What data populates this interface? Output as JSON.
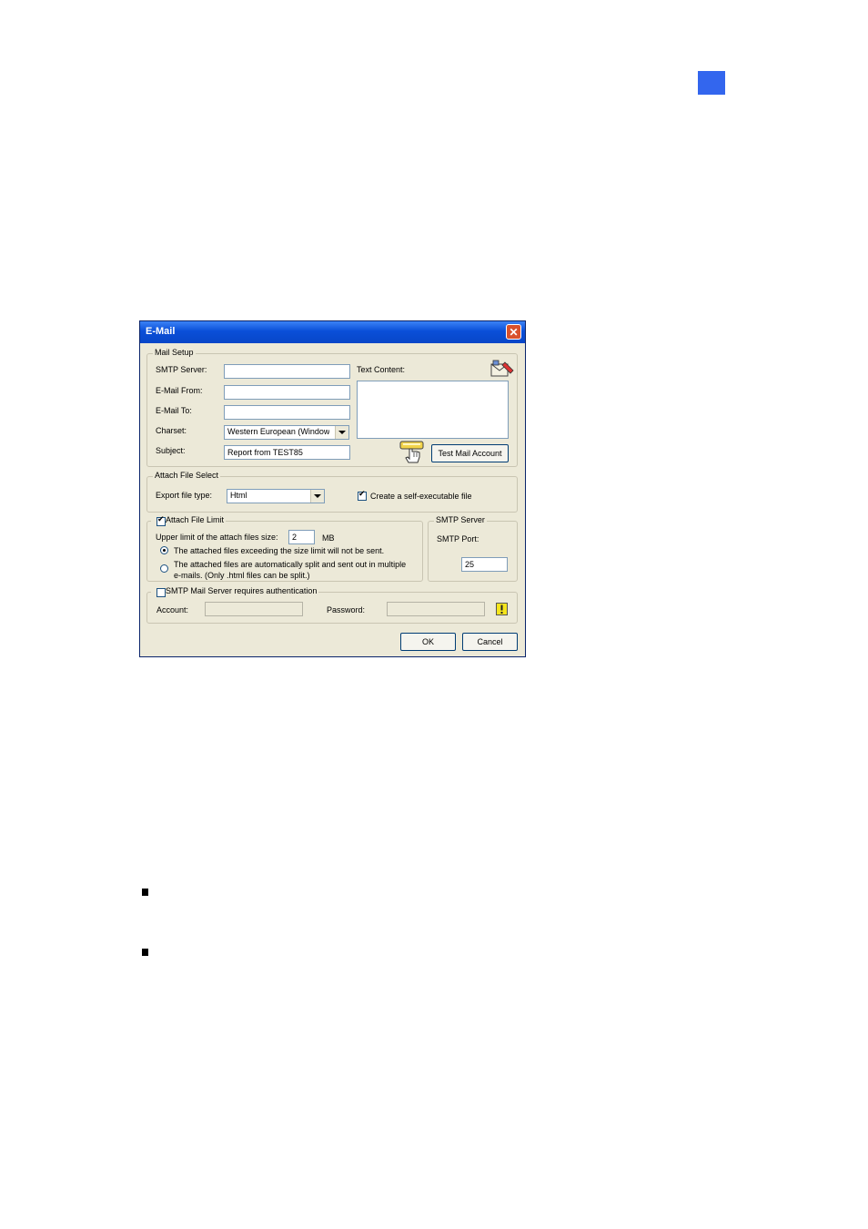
{
  "dialog": {
    "title": "E-Mail",
    "close_glyph": "✕",
    "mail_setup": {
      "legend": "Mail Setup",
      "smtp_server_label": "SMTP Server:",
      "smtp_server_value": "",
      "email_from_label": "E-Mail From:",
      "email_from_value": "",
      "email_to_label": "E-Mail To:",
      "email_to_value": "",
      "charset_label": "Charset:",
      "charset_value": "Western European (Window",
      "subject_label": "Subject:",
      "subject_value": "Report from TEST85",
      "text_content_label": "Text Content:",
      "test_button": "Test Mail Account",
      "icons": [
        "mail-settings-icon",
        "hand-cursor-icon"
      ]
    },
    "attach_file_select": {
      "legend": "Attach File Select",
      "export_label": "Export file type:",
      "export_value": "Html",
      "self_exec_label": "Create a self-executable file",
      "self_exec_checked": true
    },
    "attach_file_limit": {
      "legend": "Attach File Limit",
      "checked": true,
      "upper_limit_label": "Upper limit of the attach files size:",
      "upper_limit_value": "2",
      "unit": "MB",
      "option1": "The attached files exceeding the size limit will not be sent.",
      "option2_line1": "The attached files are automatically split and sent out in multiple",
      "option2_line2": "e-mails. (Only .html files can be split.)",
      "selected_option": 1
    },
    "smtp_server": {
      "legend": "SMTP Server",
      "port_label": "SMTP Port:",
      "port_value": "25"
    },
    "auth": {
      "legend": "SMTP Mail Server requires authentication",
      "checked": false,
      "account_label": "Account:",
      "password_label": "Password:",
      "warning_icon": "warning-icon"
    },
    "ok_button": "OK",
    "cancel_button": "Cancel"
  },
  "colors": {
    "title_bar": "#0a4fd8",
    "dialog_bg": "#ece9d8",
    "page_marker": "#3366ee"
  }
}
